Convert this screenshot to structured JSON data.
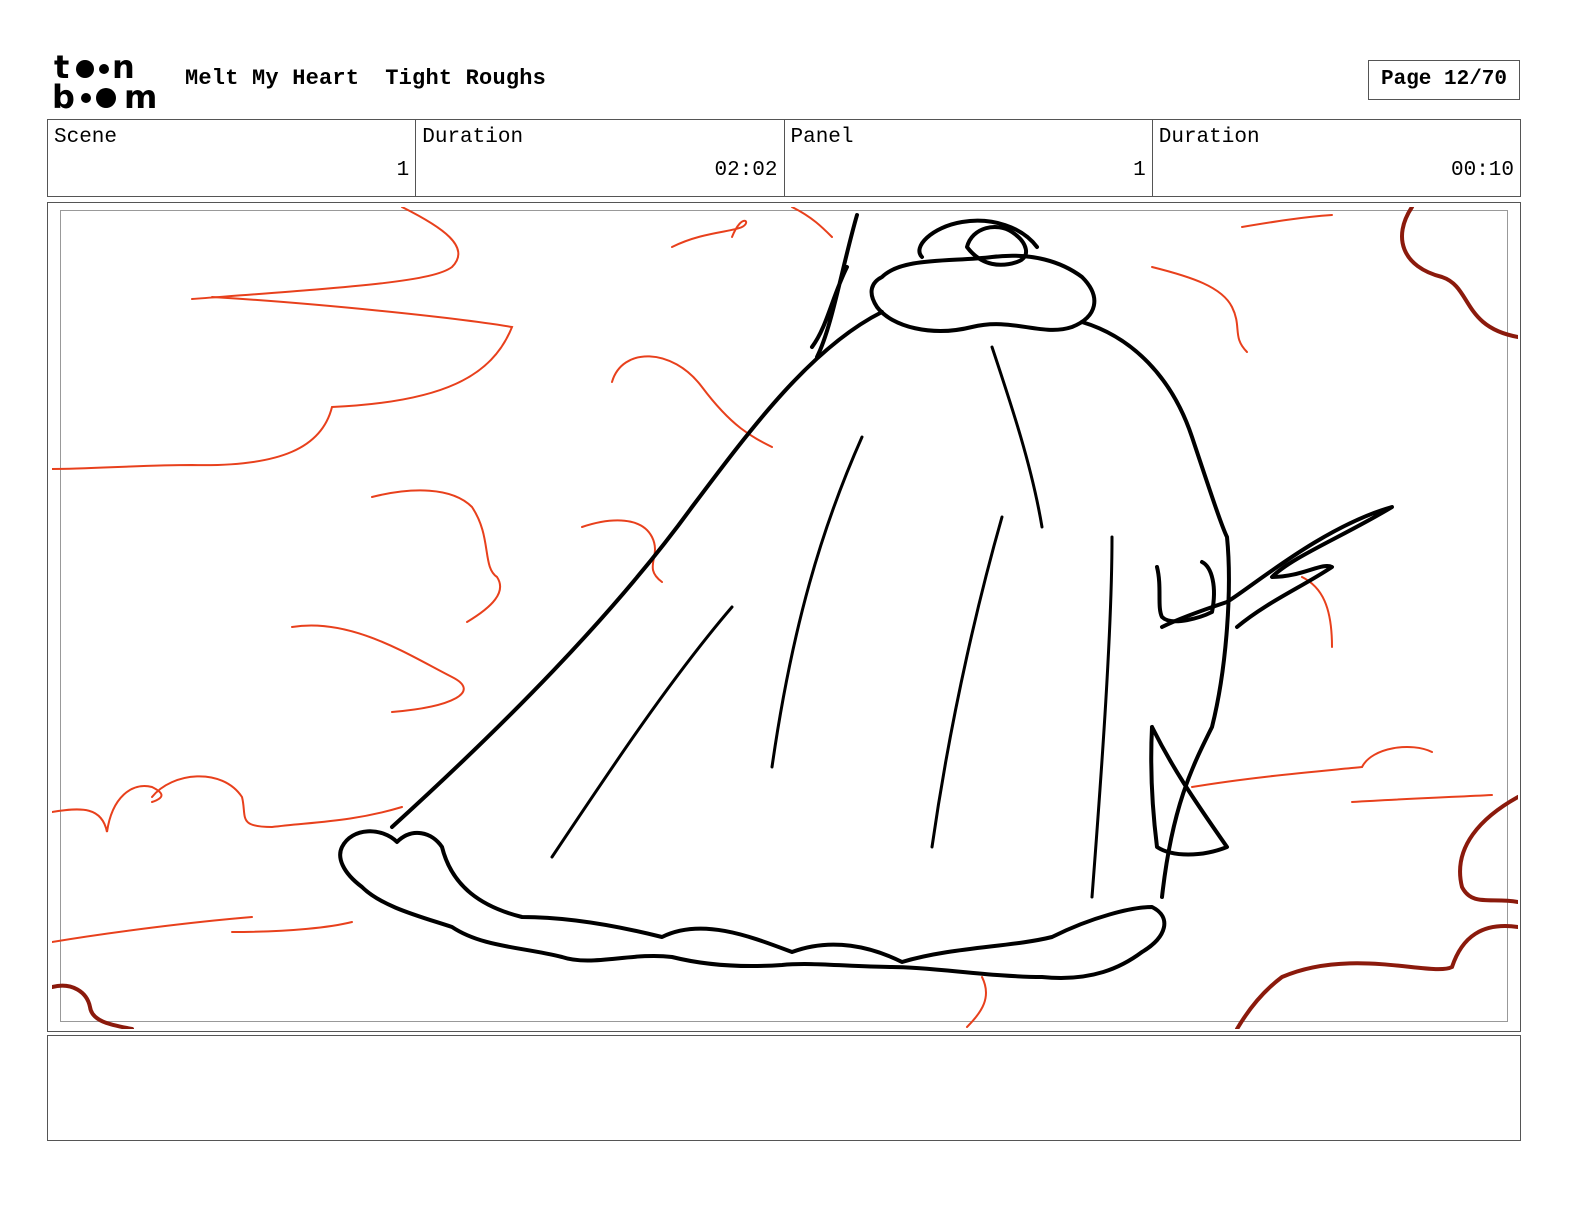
{
  "header": {
    "logo_text": [
      "t",
      "n",
      "b",
      "m"
    ],
    "project_title": "Melt My Heart",
    "section_title": "Tight Roughs",
    "page_label": "Page 12/70"
  },
  "info": {
    "scene_label": "Scene",
    "scene_value": "1",
    "scene_duration_label": "Duration",
    "scene_duration_value": "02:02",
    "panel_label": "Panel",
    "panel_value": "1",
    "panel_duration_label": "Duration",
    "panel_duration_value": "00:10"
  },
  "notes": {
    "text": ""
  },
  "colors": {
    "line_art": "#000000",
    "cloud_sketch": "#e8401c",
    "dark_sketch": "#8b1a0c",
    "border": "#555555"
  }
}
